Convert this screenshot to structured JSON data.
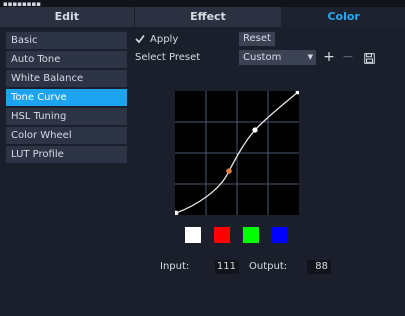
{
  "tabs": [
    {
      "label": "Edit"
    },
    {
      "label": "Effect"
    },
    {
      "label": "Color"
    }
  ],
  "active_tab": "Color",
  "sidebar": {
    "items": [
      {
        "label": "Basic"
      },
      {
        "label": "Auto Tone"
      },
      {
        "label": "White Balance"
      },
      {
        "label": "Tone Curve"
      },
      {
        "label": "HSL Tuning"
      },
      {
        "label": "Color Wheel"
      },
      {
        "label": "LUT Profile"
      }
    ],
    "active": "Tone Curve"
  },
  "controls": {
    "apply_label": "Apply",
    "apply_checked": true,
    "reset_label": "Reset",
    "preset_label": "Select Preset",
    "preset_value": "Custom"
  },
  "icons": {
    "add": "plus-icon",
    "remove": "minus-icon",
    "save": "floppy-disk-icon"
  },
  "channels": [
    {
      "name": "white",
      "color": "#ffffff"
    },
    {
      "name": "red",
      "color": "#ff0000"
    },
    {
      "name": "green",
      "color": "#00ff00"
    },
    {
      "name": "blue",
      "color": "#0000ff"
    }
  ],
  "readouts": {
    "input_label": "Input:",
    "input_value": "111",
    "output_label": "Output:",
    "output_value": "88"
  },
  "colors": {
    "accent": "#1ea3f0",
    "background": "#1a1f2b",
    "curve_line": "#e6e6e6",
    "curve_selected_point": "#e08040"
  }
}
